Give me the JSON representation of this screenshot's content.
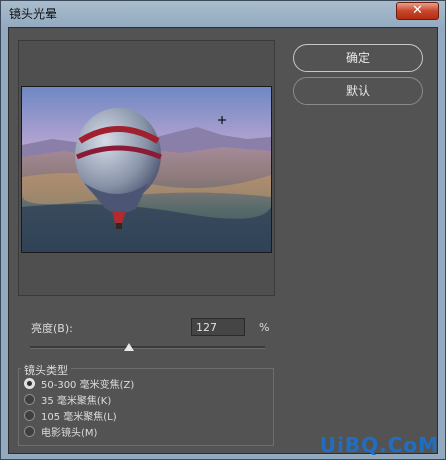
{
  "window": {
    "title": "镜头光晕",
    "close_label": "✕"
  },
  "buttons": {
    "ok": "确定",
    "reset": "默认"
  },
  "brightness": {
    "label": "亮度(B):",
    "value": "127",
    "unit": "%",
    "level": 127,
    "max": 300
  },
  "lens_type": {
    "title": "镜头类型",
    "options": [
      {
        "label": "50-300 毫米变焦(Z)",
        "checked": true
      },
      {
        "label": "35 毫米聚焦(K)",
        "checked": false
      },
      {
        "label": "105 毫米聚焦(L)",
        "checked": false
      },
      {
        "label": "电影镜头(M)",
        "checked": false
      }
    ]
  },
  "watermark": "UiBQ.CoM"
}
